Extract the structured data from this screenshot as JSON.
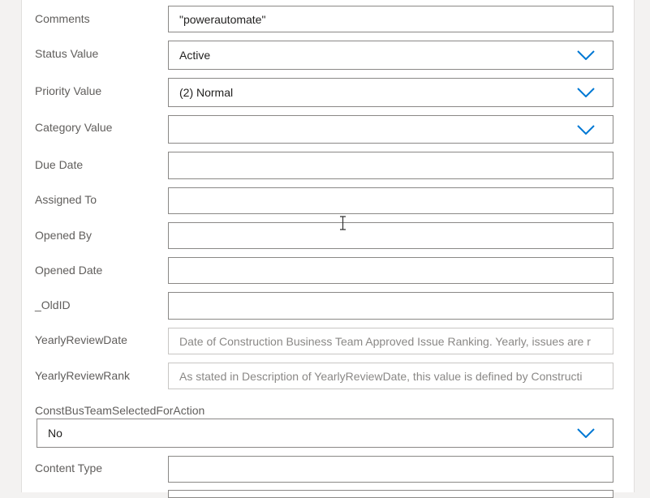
{
  "form": {
    "fields": [
      {
        "label": "Comments",
        "value": "\"powerautomate\"",
        "placeholder": "",
        "type": "text"
      },
      {
        "label": "Status Value",
        "value": "Active",
        "placeholder": "",
        "type": "dropdown"
      },
      {
        "label": "Priority Value",
        "value": "(2) Normal",
        "placeholder": "",
        "type": "dropdown"
      },
      {
        "label": "Category Value",
        "value": "",
        "placeholder": "",
        "type": "dropdown"
      },
      {
        "label": "Due Date",
        "value": "",
        "placeholder": "",
        "type": "text"
      },
      {
        "label": "Assigned To",
        "value": "",
        "placeholder": "",
        "type": "text"
      },
      {
        "label": "Opened By",
        "value": "",
        "placeholder": "",
        "type": "text"
      },
      {
        "label": "Opened Date",
        "value": "",
        "placeholder": "",
        "type": "text"
      },
      {
        "label": "_OldID",
        "value": "",
        "placeholder": "",
        "type": "text"
      },
      {
        "label": "YearlyReviewDate",
        "value": "",
        "placeholder": "Date of Construction Business Team Approved Issue Ranking. Yearly, issues are r",
        "type": "text"
      },
      {
        "label": "YearlyReviewRank",
        "value": "",
        "placeholder": "As stated in Description of YearlyReviewDate, this value is defined by Constructi",
        "type": "text"
      },
      {
        "label": "ConstBusTeamSelectedForAction",
        "value": "No",
        "placeholder": "",
        "type": "dropdown"
      },
      {
        "label": "Content Type",
        "value": "",
        "placeholder": "",
        "type": "text"
      }
    ]
  },
  "icons": {
    "dropdown": "chevron-down-icon",
    "cursor": "text-cursor-icon"
  },
  "colors": {
    "chevron": "#0078d4",
    "label": "#605e5c",
    "border": "#8a8886",
    "text": "#201f1e",
    "placeholder": "#8a8886"
  }
}
